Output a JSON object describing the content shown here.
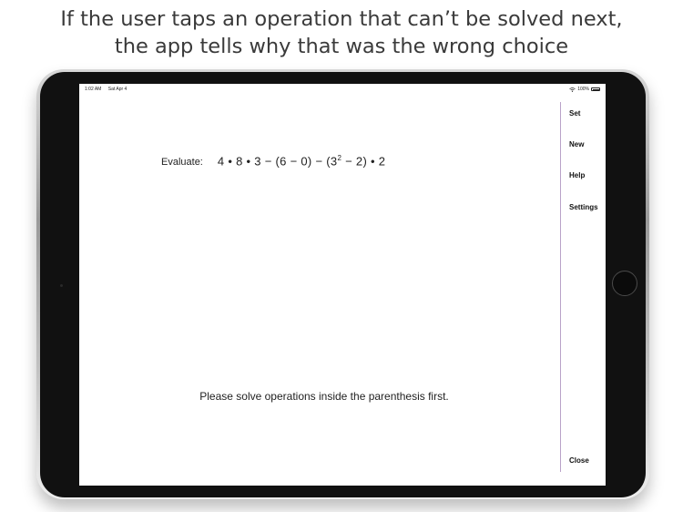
{
  "headline": {
    "line1": "If the user taps an operation that can’t be solved next,",
    "line2": "the app tells why that was the wrong choice"
  },
  "status_bar": {
    "time": "1:02 AM",
    "date": "Sat Apr 4",
    "battery_text": "100%"
  },
  "problem": {
    "label": "Evaluate:",
    "expression_before_power": "4 • 8 • 3 − (6 − 0) − (3",
    "exponent": "2",
    "expression_after_power": " − 2) • 2"
  },
  "message": "Please solve operations inside the parenthesis first.",
  "menu": {
    "set": "Set",
    "new": "New",
    "help": "Help",
    "settings": "Settings",
    "close": "Close"
  },
  "colors": {
    "menu_divider": "#b9a2c8",
    "bezel": "#111111"
  }
}
